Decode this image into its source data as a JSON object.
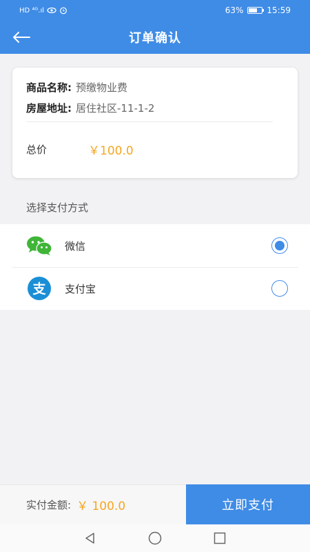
{
  "status_bar": {
    "left_indicators": "HD ⁴ᴳ.ıl",
    "battery_percent": "63%",
    "battery_level": 0.63,
    "time": "15:59"
  },
  "header": {
    "title": "订单确认"
  },
  "order": {
    "product_label": "商品名称:",
    "product_value": "预缴物业费",
    "address_label": "房屋地址:",
    "address_value": "居住社区-11-1-2",
    "total_label": "总价",
    "total_value": "￥100.0"
  },
  "payment": {
    "section_title": "选择支付方式",
    "methods": [
      {
        "name": "微信",
        "icon": "wechat-icon",
        "selected": true
      },
      {
        "name": "支付宝",
        "icon": "alipay-icon",
        "selected": false
      }
    ]
  },
  "footer": {
    "amount_label": "实付金额:",
    "amount_value": "￥ 100.0",
    "pay_button_label": "立即支付"
  },
  "colors": {
    "primary": "#3f8ce6",
    "price": "#f5a623",
    "wechat": "#40b538",
    "alipay": "#1a8fd6"
  }
}
